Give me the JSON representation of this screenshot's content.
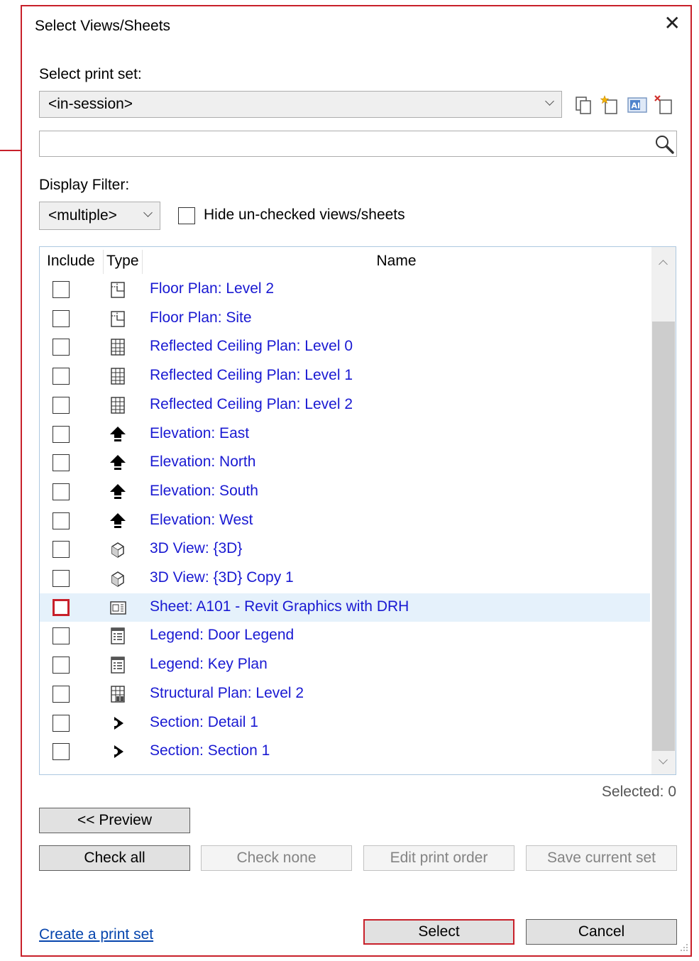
{
  "dialog": {
    "title": "Select Views/Sheets",
    "close_glyph": "✕"
  },
  "print_set": {
    "label": "Select print set:",
    "value": "<in-session>",
    "toolbar_icons": [
      "duplicate-icon",
      "new-set-icon",
      "rename-icon",
      "delete-set-icon"
    ]
  },
  "search": {
    "value": "",
    "placeholder": "",
    "icon": "search-icon"
  },
  "display_filter": {
    "label": "Display Filter:",
    "value": "<multiple>",
    "hide_unchecked_label": "Hide un-checked views/sheets",
    "hide_unchecked_checked": false
  },
  "list": {
    "columns": [
      "Include",
      "Type",
      "Name"
    ],
    "rows": [
      {
        "name": "Floor Plan: Level 2",
        "icon": "floor-plan-icon",
        "checked": false
      },
      {
        "name": "Floor Plan: Site",
        "icon": "floor-plan-icon",
        "checked": false
      },
      {
        "name": "Reflected Ceiling Plan: Level 0",
        "icon": "ceiling-plan-icon",
        "checked": false
      },
      {
        "name": "Reflected Ceiling Plan: Level 1",
        "icon": "ceiling-plan-icon",
        "checked": false
      },
      {
        "name": "Reflected Ceiling Plan: Level 2",
        "icon": "ceiling-plan-icon",
        "checked": false
      },
      {
        "name": "Elevation: East",
        "icon": "elevation-icon",
        "checked": false
      },
      {
        "name": "Elevation: North",
        "icon": "elevation-icon",
        "checked": false
      },
      {
        "name": "Elevation: South",
        "icon": "elevation-icon",
        "checked": false
      },
      {
        "name": "Elevation: West",
        "icon": "elevation-icon",
        "checked": false
      },
      {
        "name": "3D View: {3D}",
        "icon": "3d-view-icon",
        "checked": false
      },
      {
        "name": "3D View: {3D} Copy 1",
        "icon": "3d-view-icon",
        "checked": false
      },
      {
        "name": "Sheet: A101 - Revit Graphics with DRH",
        "icon": "sheet-icon",
        "checked": false,
        "highlighted": true
      },
      {
        "name": "Legend: Door Legend",
        "icon": "legend-icon",
        "checked": false
      },
      {
        "name": "Legend: Key Plan",
        "icon": "legend-icon",
        "checked": false
      },
      {
        "name": "Structural Plan: Level 2",
        "icon": "structural-plan-icon",
        "checked": false
      },
      {
        "name": "Section: Detail 1",
        "icon": "section-icon",
        "checked": false
      },
      {
        "name": "Section: Section 1",
        "icon": "section-icon",
        "checked": false
      }
    ]
  },
  "selected_count_text": "Selected: 0",
  "buttons": {
    "preview": "<< Preview",
    "check_all": "Check all",
    "check_none": "Check none",
    "edit_print_order": "Edit print order",
    "save_current_set": "Save current set",
    "select": "Select",
    "cancel": "Cancel"
  },
  "create_print_set_link": "Create a print set",
  "colors": {
    "accent_border": "#c8202a",
    "link_blue": "#1919d2",
    "row_highlight": "#e5f1fb"
  }
}
